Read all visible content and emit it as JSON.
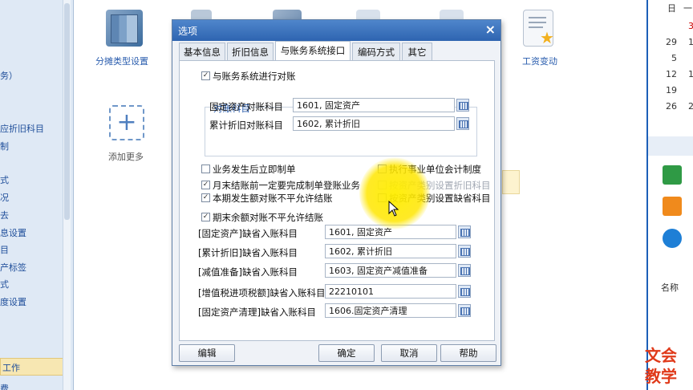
{
  "left_sidebar": {
    "items": [
      "务）",
      "应折旧科目",
      "制",
      "式",
      "况",
      "去",
      "息设置",
      "目",
      "产标签",
      "式",
      "度设置"
    ],
    "active_item": "工作",
    "bottom_text": "费"
  },
  "desktop": {
    "icons": [
      {
        "label": "分摊类型设置",
        "icon": "books-icon"
      },
      {
        "label": "工资变动",
        "icon": "document-star-icon"
      },
      {
        "label": "添加更多",
        "icon": "plus-icon"
      }
    ]
  },
  "right_panel": {
    "header_glyphs": [
      "日",
      "一"
    ],
    "calendar_numbers": [
      "29",
      "5",
      "12",
      "19",
      "26"
    ],
    "calendar_red": [
      "3"
    ],
    "partial_labels": [
      "1",
      "1",
      "2"
    ],
    "column_label": "名称"
  },
  "dialog": {
    "title": "选项",
    "close_glyph": "×",
    "tabs": [
      "基本信息",
      "折旧信息",
      "与账务系统接口",
      "编码方式",
      "其它"
    ],
    "active_tab": "与账务系统接口",
    "connect_checkbox": {
      "label": "与账务系统进行对账",
      "checked": true
    },
    "group_title": "对账科目",
    "reconcile_fields": [
      {
        "label": "固定资产对账科目",
        "value": "1601, 固定资产"
      },
      {
        "label": "累计折旧对账科目",
        "value": "1602, 累计折旧"
      }
    ],
    "left_checks": [
      {
        "label": "业务发生后立即制单",
        "checked": false
      },
      {
        "label": "月末结账前一定要完成制单登账业务",
        "checked": true
      },
      {
        "label": "本期发生额对账不平允许结账",
        "checked": true
      },
      {
        "label": "期末余额对账不平允许结账",
        "checked": true
      }
    ],
    "right_checks": [
      {
        "label": "执行事业单位会计制度",
        "checked": false,
        "disabled": false
      },
      {
        "label": "按资产类别设置折旧科目",
        "checked": false,
        "disabled": true
      },
      {
        "label": "按资产类别设置缺省科目",
        "checked": false,
        "disabled": false
      }
    ],
    "default_fields": [
      {
        "label": "[固定资产]缺省入账科目",
        "value": "1601, 固定资产"
      },
      {
        "label": "[累计折旧]缺省入账科目",
        "value": "1602, 累计折旧"
      },
      {
        "label": "[减值准备]缺省入账科目",
        "value": "1603, 固定资产减值准备"
      },
      {
        "label": "[增值税进项税额]缺省入账科目",
        "value": "22210101"
      },
      {
        "label": "[固定资产清理]缺省入账科目",
        "value": "1606.固定资产清理"
      }
    ],
    "buttons": {
      "edit": "编辑",
      "ok": "确定",
      "cancel": "取消",
      "help": "帮助"
    }
  },
  "watermark": [
    "文会",
    "教学"
  ],
  "colors": {
    "titlebar": "#2e64b0",
    "highlight": "#ffe600",
    "watermark": "#e03a1a",
    "link": "#2a5dae"
  }
}
